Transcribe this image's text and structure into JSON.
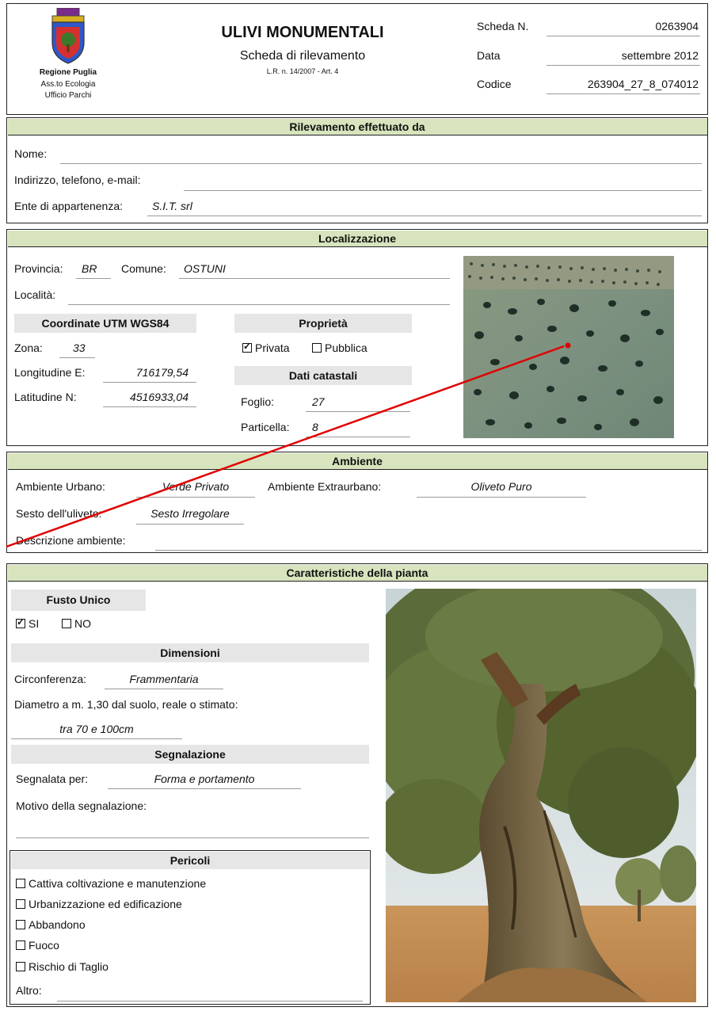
{
  "header": {
    "region": "Regione Puglia",
    "dept": "Ass.to Ecologia",
    "office": "Ufficio Parchi",
    "title": "ULIVI MONUMENTALI",
    "subtitle": "Scheda di rilevamento",
    "law": "L.R. n. 14/2007 - Art. 4",
    "scheda_label": "Scheda N.",
    "scheda_value": "0263904",
    "data_label": "Data",
    "data_value": "settembre 2012",
    "codice_label": "Codice",
    "codice_value": "263904_27_8_074012"
  },
  "rilevamento": {
    "heading": "Rilevamento effettuato da",
    "nome_label": "Nome:",
    "nome_value": "",
    "contatti_label": "Indirizzo, telefono, e-mail:",
    "contatti_value": "",
    "ente_label": "Ente di appartenenza:",
    "ente_value": "S.I.T. srl"
  },
  "localizzazione": {
    "heading": "Localizzazione",
    "provincia_label": "Provincia:",
    "provincia_value": "BR",
    "comune_label": "Comune:",
    "comune_value": "OSTUNI",
    "localita_label": "Località:",
    "localita_value": "",
    "coord_heading": "Coordinate UTM WGS84",
    "zona_label": "Zona:",
    "zona_value": "33",
    "lon_label": "Longitudine E:",
    "lon_value": "716179,54",
    "lat_label": "Latitudine N:",
    "lat_value": "4516933,04",
    "proprieta_heading": "Proprietà",
    "privata_label": "Privata",
    "privata_checked": true,
    "pubblica_label": "Pubblica",
    "pubblica_checked": false,
    "catastali_heading": "Dati catastali",
    "foglio_label": "Foglio:",
    "foglio_value": "27",
    "particella_label": "Particella:",
    "particella_value": "8"
  },
  "ambiente": {
    "heading": "Ambiente",
    "urbano_label": "Ambiente Urbano:",
    "urbano_value": "Verde Privato",
    "extraurbano_label": "Ambiente Extraurbano:",
    "extraurbano_value": "Oliveto Puro",
    "sesto_label": "Sesto dell'uliveto:",
    "sesto_value": "Sesto Irregolare",
    "descrizione_label": "Descrizione ambiente:",
    "descrizione_value": ""
  },
  "pianta": {
    "heading": "Caratteristiche della pianta",
    "fusto_heading": "Fusto Unico",
    "si_label": "SI",
    "si_checked": true,
    "no_label": "NO",
    "no_checked": false,
    "dimensioni_heading": "Dimensioni",
    "circ_label": "Circonferenza:",
    "circ_value": "Frammentaria",
    "diam_label": "Diametro a m. 1,30 dal suolo, reale o stimato:",
    "diam_value": "tra 70 e 100cm",
    "segnalazione_heading": "Segnalazione",
    "segnalata_label": "Segnalata per:",
    "segnalata_value": "Forma e portamento",
    "motivo_label": "Motivo della segnalazione:",
    "motivo_value": ""
  },
  "pericoli": {
    "heading": "Pericoli",
    "items": [
      {
        "label": "Cattiva coltivazione e manutenzione",
        "checked": false
      },
      {
        "label": "Urbanizzazione ed edificazione",
        "checked": false
      },
      {
        "label": "Abbandono",
        "checked": false
      },
      {
        "label": "Fuoco",
        "checked": false
      },
      {
        "label": "Rischio di Taglio",
        "checked": false
      }
    ],
    "altro_label": "Altro:",
    "altro_value": ""
  },
  "colors": {
    "band_green": "#d7e4bd",
    "gray_bar": "#e6e6e6",
    "pointer_red": "#e00000"
  }
}
